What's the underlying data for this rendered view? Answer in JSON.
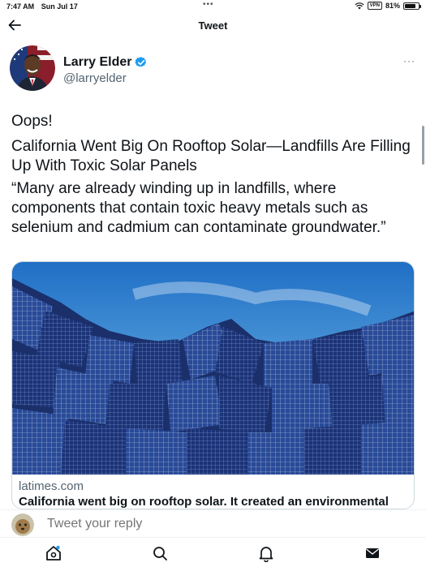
{
  "status_bar": {
    "time": "7:47 AM",
    "date": "Sun Jul 17",
    "dots": "•••",
    "vpn": "VPN",
    "battery": "81%",
    "battery_level": 0.81
  },
  "header": {
    "title": "Tweet",
    "back_icon": "back-arrow-icon"
  },
  "author": {
    "name": "Larry Elder",
    "handle": "@larryelder",
    "verified_icon": "verified-badge-icon",
    "more": "···"
  },
  "tweet": {
    "line1": "Oops!",
    "headline": "California Went Big On Rooftop Solar—Landfills Are Filling Up With Toxic Solar Panels",
    "quote": "“Many are already winding up in landfills, where components that contain toxic heavy metals such as selenium and cadmium can contaminate groundwater.”"
  },
  "link_card": {
    "domain": "latimes.com",
    "title": "California went big on rooftop solar. It created an environmental"
  },
  "reply": {
    "placeholder": "Tweet your reply"
  },
  "tab_bar": {
    "tabs": [
      "home-icon",
      "search-icon",
      "notifications-icon",
      "messages-icon"
    ]
  },
  "colors": {
    "verified": "#1d9bf0",
    "secondary_text": "#536471",
    "border": "#cfd9de"
  }
}
